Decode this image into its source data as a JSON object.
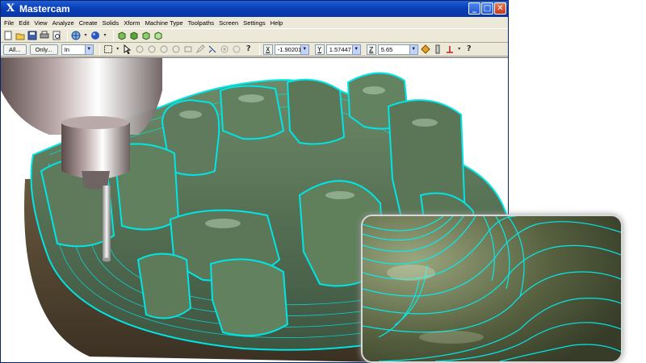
{
  "window": {
    "title": "Mastercam",
    "title_icon": "X",
    "controls": {
      "minimize": "_",
      "maximize": "□",
      "close": "✕"
    }
  },
  "menu": [
    "File",
    "Edit",
    "View",
    "Analyze",
    "Create",
    "Solids",
    "Xform",
    "Machine Type",
    "Toolpaths",
    "Screen",
    "Settings",
    "Help"
  ],
  "toolbar2": {
    "all_button": "All...",
    "only_button": "Only...",
    "level_select": "In",
    "x_label": "X",
    "x_value": "-1.90201",
    "y_label": "Y",
    "y_value": "1.57447",
    "z_label": "Z",
    "z_value": "5.65",
    "help_glyph": "?"
  },
  "icons": {
    "toolbar1": [
      "new-file-icon",
      "open-folder-icon",
      "save-icon",
      "print-icon",
      "preview-icon",
      "globe-icon",
      "sphere-icon",
      "cube-front-icon",
      "cube-top-icon",
      "cube-side-icon",
      "cube-iso-icon"
    ],
    "toolbar2": [
      "select-box-icon",
      "arrow-select-icon",
      "circle-icon",
      "help-icon",
      "x-axis-icon",
      "y-axis-icon",
      "z-axis-icon",
      "autocursor-icon",
      "gnomon-icon",
      "help2-icon"
    ]
  },
  "colors": {
    "titlebar": "#0a3fb8",
    "toolpath": "#00e5e5",
    "part_surface": "#4f6a4c",
    "stock_base": "#5a4a34"
  }
}
